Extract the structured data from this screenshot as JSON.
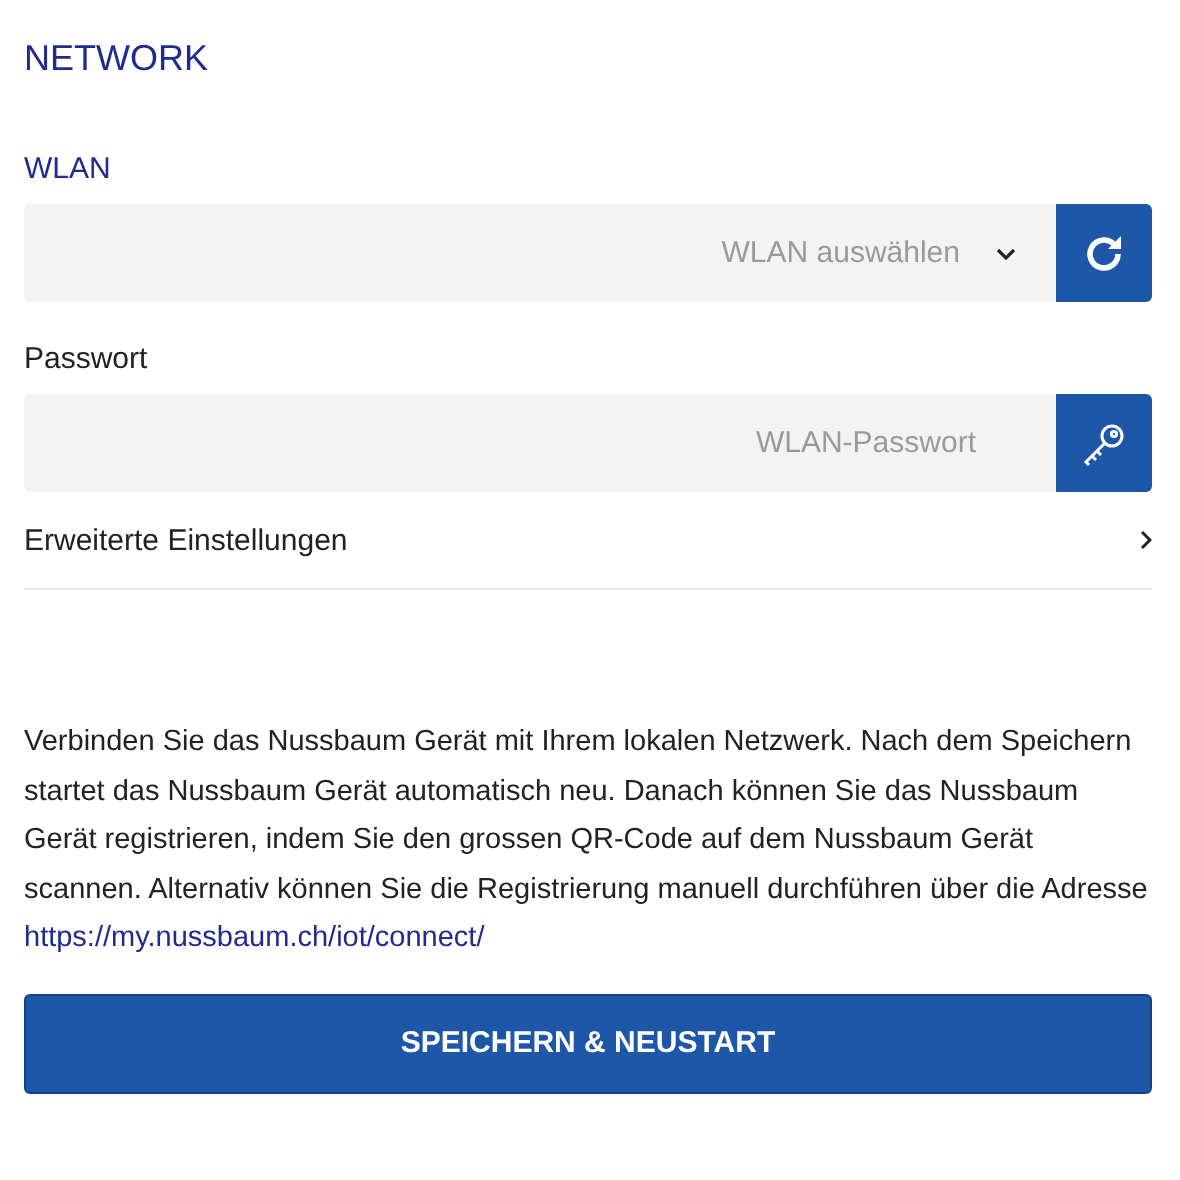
{
  "title": "NETWORK",
  "wlan": {
    "label": "WLAN",
    "placeholder": "WLAN auswählen"
  },
  "password": {
    "label": "Passwort",
    "placeholder": "WLAN-Passwort"
  },
  "advanced": {
    "label": "Erweiterte Einstellungen"
  },
  "info": {
    "text": "Verbinden Sie das Nussbaum Gerät mit Ihrem lokalen Netzwerk. Nach dem Speichern startet das Nussbaum Gerät automatisch neu. Danach können Sie das Nussbaum Gerät registrieren, indem Sie den grossen QR-Code auf dem Nussbaum Gerät scannen. Alternativ können Sie die Registrierung manuell durchführen über die Adresse",
    "link": "https://my.nussbaum.ch/iot/connect/"
  },
  "submit": "SPEICHERN & NEUSTART"
}
